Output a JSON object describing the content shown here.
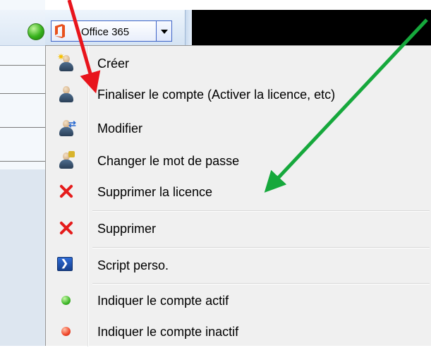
{
  "combo": {
    "label": "Office 365",
    "status_color": "#37b21c"
  },
  "menu": {
    "items": [
      {
        "label": "Créer",
        "icon": "user-add-icon"
      },
      {
        "label": "Finaliser le compte (Activer la licence, etc)",
        "icon": "user-icon"
      },
      {
        "label": "Modifier",
        "icon": "user-edit-icon"
      },
      {
        "label": "Changer le mot de passe",
        "icon": "user-lock-icon"
      },
      {
        "label": "Supprimer la licence",
        "icon": "delete-x-icon"
      },
      {
        "label": "Supprimer",
        "icon": "delete-x-icon"
      },
      {
        "label": "Script perso.",
        "icon": "powershell-icon"
      },
      {
        "label": "Indiquer le compte actif",
        "icon": "green-dot-icon"
      },
      {
        "label": "Indiquer le compte inactif",
        "icon": "red-dot-icon"
      }
    ]
  },
  "annotations": {
    "red_arrow_color": "#e8141c",
    "green_arrow_color": "#16a83c"
  }
}
